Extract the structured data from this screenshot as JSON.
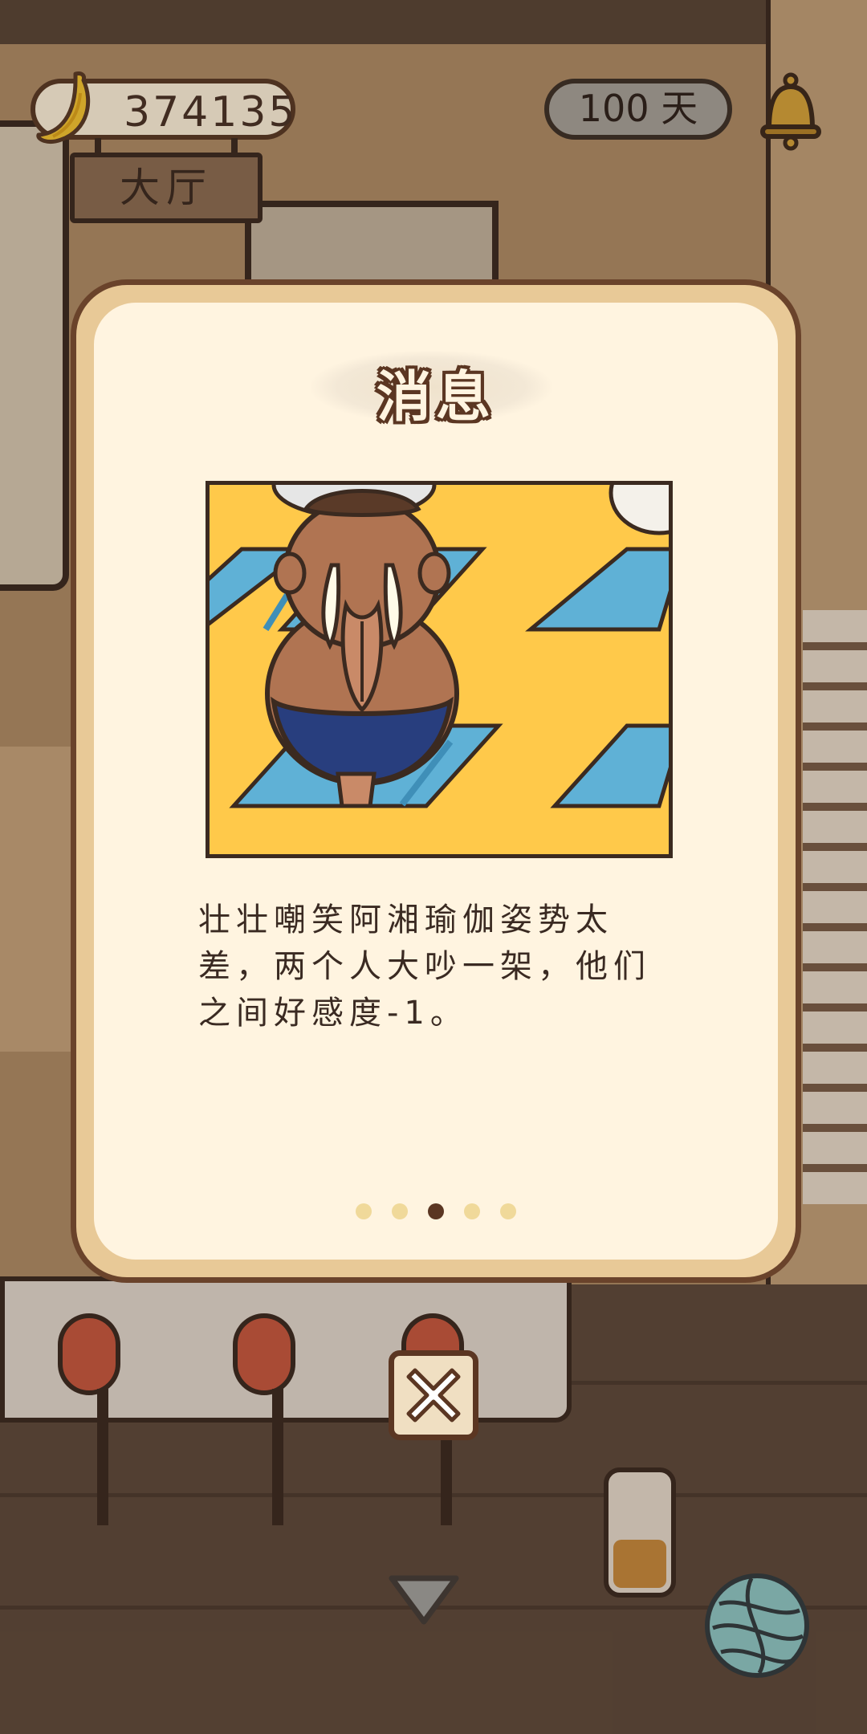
{
  "hud": {
    "currency_value": "374135",
    "currency_icon": "banana-icon",
    "day_label": "100 天",
    "bell_icon": "bell-icon",
    "room_name": "大厅"
  },
  "dialog": {
    "title": "消息",
    "story_text": "壮壮嘲笑阿湘瑜伽姿势太差，两个人大吵一架，他们之间好感度-1。",
    "illustration": "walrus-yoga-pose",
    "page_count": 5,
    "current_page": 3
  },
  "controls": {
    "close_icon": "close-icon",
    "collapse_icon": "chevron-down-icon",
    "yarn_icon": "yarn-ball-icon"
  },
  "colors": {
    "panel_border": "#6a432b",
    "panel_fill": "#fff4e0",
    "accent_brown": "#5b3622",
    "yoga_floor": "#ffc94a",
    "yoga_mat": "#5fb1d6"
  }
}
